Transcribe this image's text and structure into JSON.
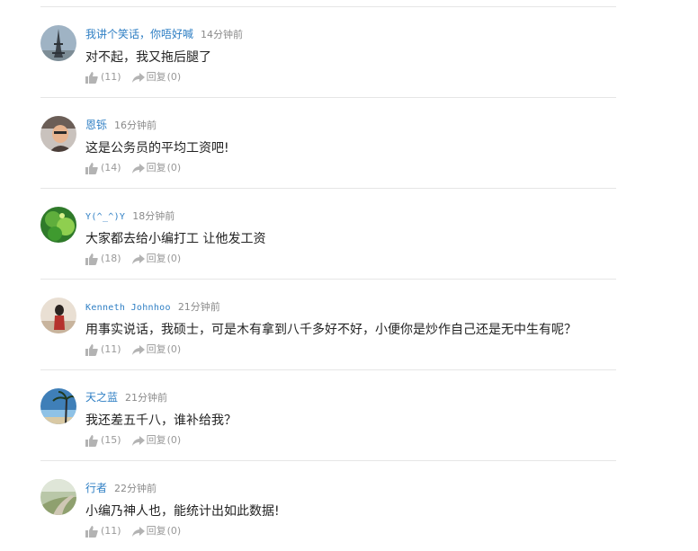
{
  "colors": {
    "username": "#2f7fc4",
    "timestamp": "#8a8a8a",
    "content": "#222222",
    "action": "#999999",
    "divider": "#e6e6e6"
  },
  "icons": {
    "like": "thumbs-up-icon",
    "reply": "share-arrow-icon"
  },
  "comments": [
    {
      "username": "我讲个笑话，你唔好喊",
      "time": "14分钟前",
      "content": "对不起，我又拖后腿了",
      "likes": "(11)",
      "reply_label": "回复",
      "replies": "(0)"
    },
    {
      "username": "恩铄",
      "time": "16分钟前",
      "content": "这是公务员的平均工资吧!",
      "likes": "(14)",
      "reply_label": "回复",
      "replies": "(0)"
    },
    {
      "username": "Y(^_^)Y",
      "time": "18分钟前",
      "content": "大家都去给小编打工 让他发工资",
      "likes": "(18)",
      "reply_label": "回复",
      "replies": "(0)"
    },
    {
      "username": "Kenneth Johnhoo",
      "time": "21分钟前",
      "content": "用事实说话，我硕士，可是木有拿到八千多好不好，小便你是炒作自己还是无中生有呢？",
      "likes": "(11)",
      "reply_label": "回复",
      "replies": "(0)"
    },
    {
      "username": "天之蓝",
      "time": "21分钟前",
      "content": "我还差五千八，谁补给我？",
      "likes": "(15)",
      "reply_label": "回复",
      "replies": "(0)"
    },
    {
      "username": "行者",
      "time": "22分钟前",
      "content": "小编乃神人也，能统计出如此数据!",
      "likes": "(11)",
      "reply_label": "回复",
      "replies": "(0)"
    }
  ]
}
